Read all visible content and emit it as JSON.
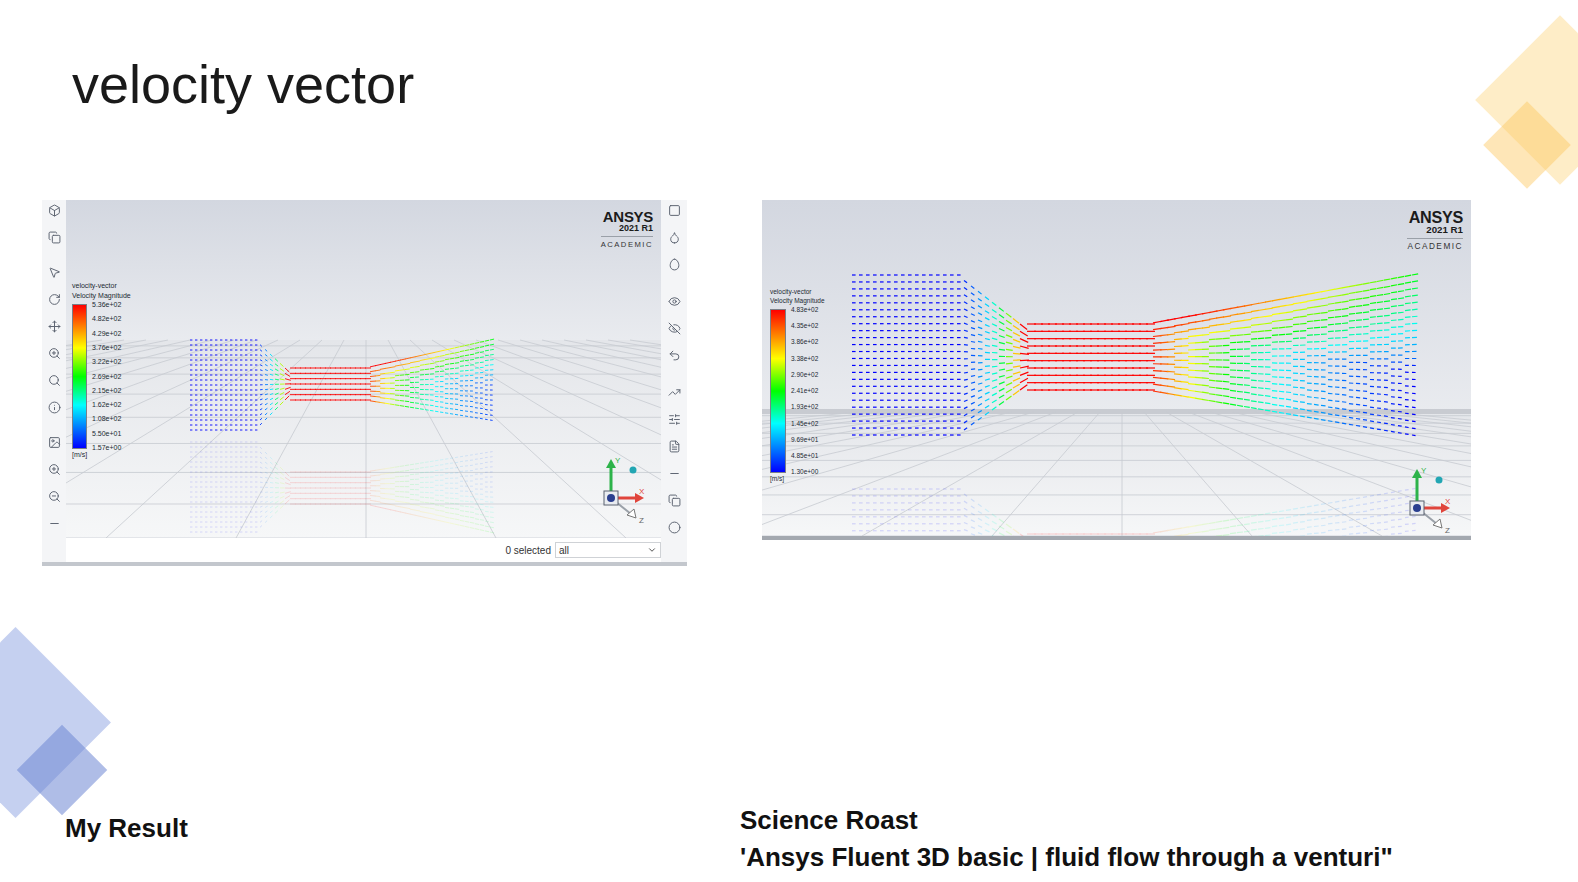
{
  "slide": {
    "title": "velocity vector"
  },
  "panels": [
    {
      "kind": "app-window",
      "logo": {
        "brand": "ANSYS",
        "version": "2021 R1",
        "edition": "ACADEMIC"
      },
      "legend": {
        "title": "velocity-vector",
        "quantity": "Velocity Magnitude",
        "ticks": [
          "5.36e+02",
          "4.82e+02",
          "4.29e+02",
          "3.76e+02",
          "3.22e+02",
          "2.69e+02",
          "2.15e+02",
          "1.62e+02",
          "1.08e+02",
          "5.50e+01",
          "1.57e+00"
        ],
        "unit": "[m/s]"
      },
      "axes": [
        "X",
        "Y",
        "Z"
      ],
      "status": {
        "selection": "0 selected",
        "filter": "all"
      },
      "caption": [
        "My Result"
      ]
    },
    {
      "kind": "viewport",
      "logo": {
        "brand": "ANSYS",
        "version": "2021 R1",
        "edition": "ACADEMIC"
      },
      "legend": {
        "title": "velocity-vector",
        "quantity": "Velocity Magnitude",
        "ticks": [
          "4.83e+02",
          "4.35e+02",
          "3.86e+02",
          "3.38e+02",
          "2.90e+02",
          "2.41e+02",
          "1.93e+02",
          "1.45e+02",
          "9.69e+01",
          "4.85e+01",
          "1.30e+00"
        ],
        "unit": "[m/s]"
      },
      "axes": [
        "X",
        "Y",
        "Z"
      ],
      "caption": [
        "Science Roast",
        "'Ansys Fluent 3D basic | fluid flow through a venturi\""
      ]
    }
  ]
}
